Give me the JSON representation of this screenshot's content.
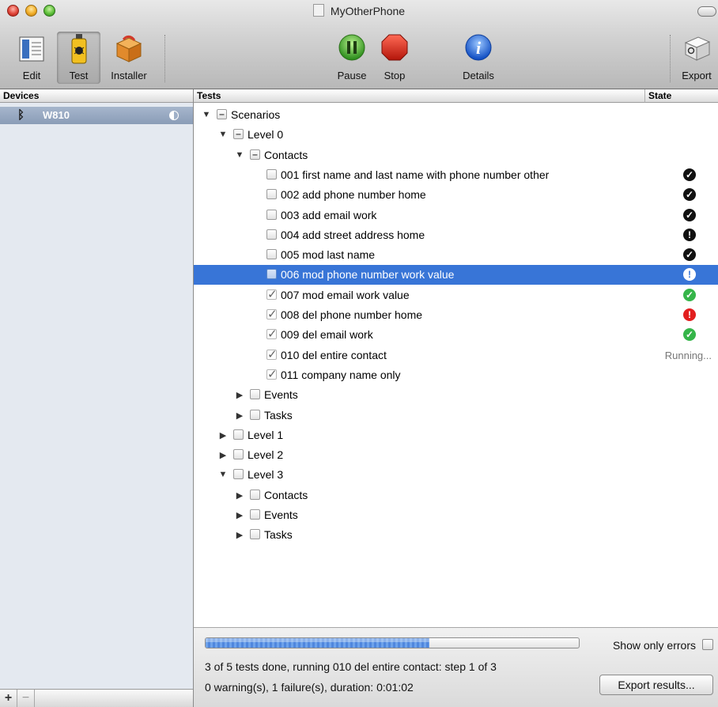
{
  "window": {
    "title": "MyOtherPhone"
  },
  "toolbar": {
    "edit_label": "Edit",
    "test_label": "Test",
    "installer_label": "Installer",
    "pause_label": "Pause",
    "stop_label": "Stop",
    "details_label": "Details",
    "export_label": "Export"
  },
  "sidebar": {
    "header": "Devices",
    "devices": [
      {
        "name": "W810"
      }
    ],
    "add_label": "+",
    "remove_label": "−"
  },
  "main": {
    "tests_header": "Tests",
    "state_header": "State",
    "rows": [
      {
        "label": "Scenarios",
        "level": 0,
        "disclosure": "open",
        "check": "mixed",
        "state": ""
      },
      {
        "label": "Level 0",
        "level": 1,
        "disclosure": "open",
        "check": "mixed",
        "state": ""
      },
      {
        "label": "Contacts",
        "level": 2,
        "disclosure": "open",
        "check": "mixed",
        "state": ""
      },
      {
        "label": "001 first name and last name with phone number other",
        "level": 3,
        "disclosure": "none",
        "check": "unchecked",
        "state": "ok-black"
      },
      {
        "label": "002 add phone number home",
        "level": 3,
        "disclosure": "none",
        "check": "unchecked",
        "state": "ok-black"
      },
      {
        "label": "003 add email work",
        "level": 3,
        "disclosure": "none",
        "check": "unchecked",
        "state": "ok-black"
      },
      {
        "label": "004 add street address home",
        "level": 3,
        "disclosure": "none",
        "check": "unchecked",
        "state": "warn-black"
      },
      {
        "label": "005 mod last name",
        "level": 3,
        "disclosure": "none",
        "check": "unchecked",
        "state": "ok-black"
      },
      {
        "label": "006 mod phone number work value",
        "level": 3,
        "disclosure": "none",
        "check": "unchecked",
        "state": "warn-white",
        "selected": true
      },
      {
        "label": "007 mod email work value",
        "level": 3,
        "disclosure": "none",
        "check": "checked",
        "state": "ok-green"
      },
      {
        "label": "008 del phone number home",
        "level": 3,
        "disclosure": "none",
        "check": "checked",
        "state": "fail-red"
      },
      {
        "label": "009 del email work",
        "level": 3,
        "disclosure": "none",
        "check": "checked",
        "state": "ok-green"
      },
      {
        "label": "010 del entire contact",
        "level": 3,
        "disclosure": "none",
        "check": "checked",
        "state": "text",
        "state_text": "Running..."
      },
      {
        "label": "011 company name only",
        "level": 3,
        "disclosure": "none",
        "check": "checked",
        "state": ""
      },
      {
        "label": "Events",
        "level": 2,
        "disclosure": "closed",
        "check": "unchecked",
        "state": ""
      },
      {
        "label": "Tasks",
        "level": 2,
        "disclosure": "closed",
        "check": "unchecked",
        "state": ""
      },
      {
        "label": "Level 1",
        "level": 1,
        "disclosure": "closed",
        "check": "unchecked",
        "state": ""
      },
      {
        "label": "Level 2",
        "level": 1,
        "disclosure": "closed",
        "check": "unchecked",
        "state": ""
      },
      {
        "label": "Level 3",
        "level": 1,
        "disclosure": "open",
        "check": "unchecked",
        "state": ""
      },
      {
        "label": "Contacts",
        "level": 2,
        "disclosure": "closed",
        "check": "unchecked",
        "state": ""
      },
      {
        "label": "Events",
        "level": 2,
        "disclosure": "closed",
        "check": "unchecked",
        "state": ""
      },
      {
        "label": "Tasks",
        "level": 2,
        "disclosure": "closed",
        "check": "unchecked",
        "state": ""
      }
    ]
  },
  "status": {
    "progress_fraction": 0.6,
    "show_only_errors_label": "Show only errors",
    "show_only_errors_checked": false,
    "line1": "3 of 5 tests done, running 010 del entire contact: step 1 of 3",
    "line2": "0 warning(s), 1 failure(s), duration: 0:01:02",
    "export_results_label": "Export results..."
  }
}
